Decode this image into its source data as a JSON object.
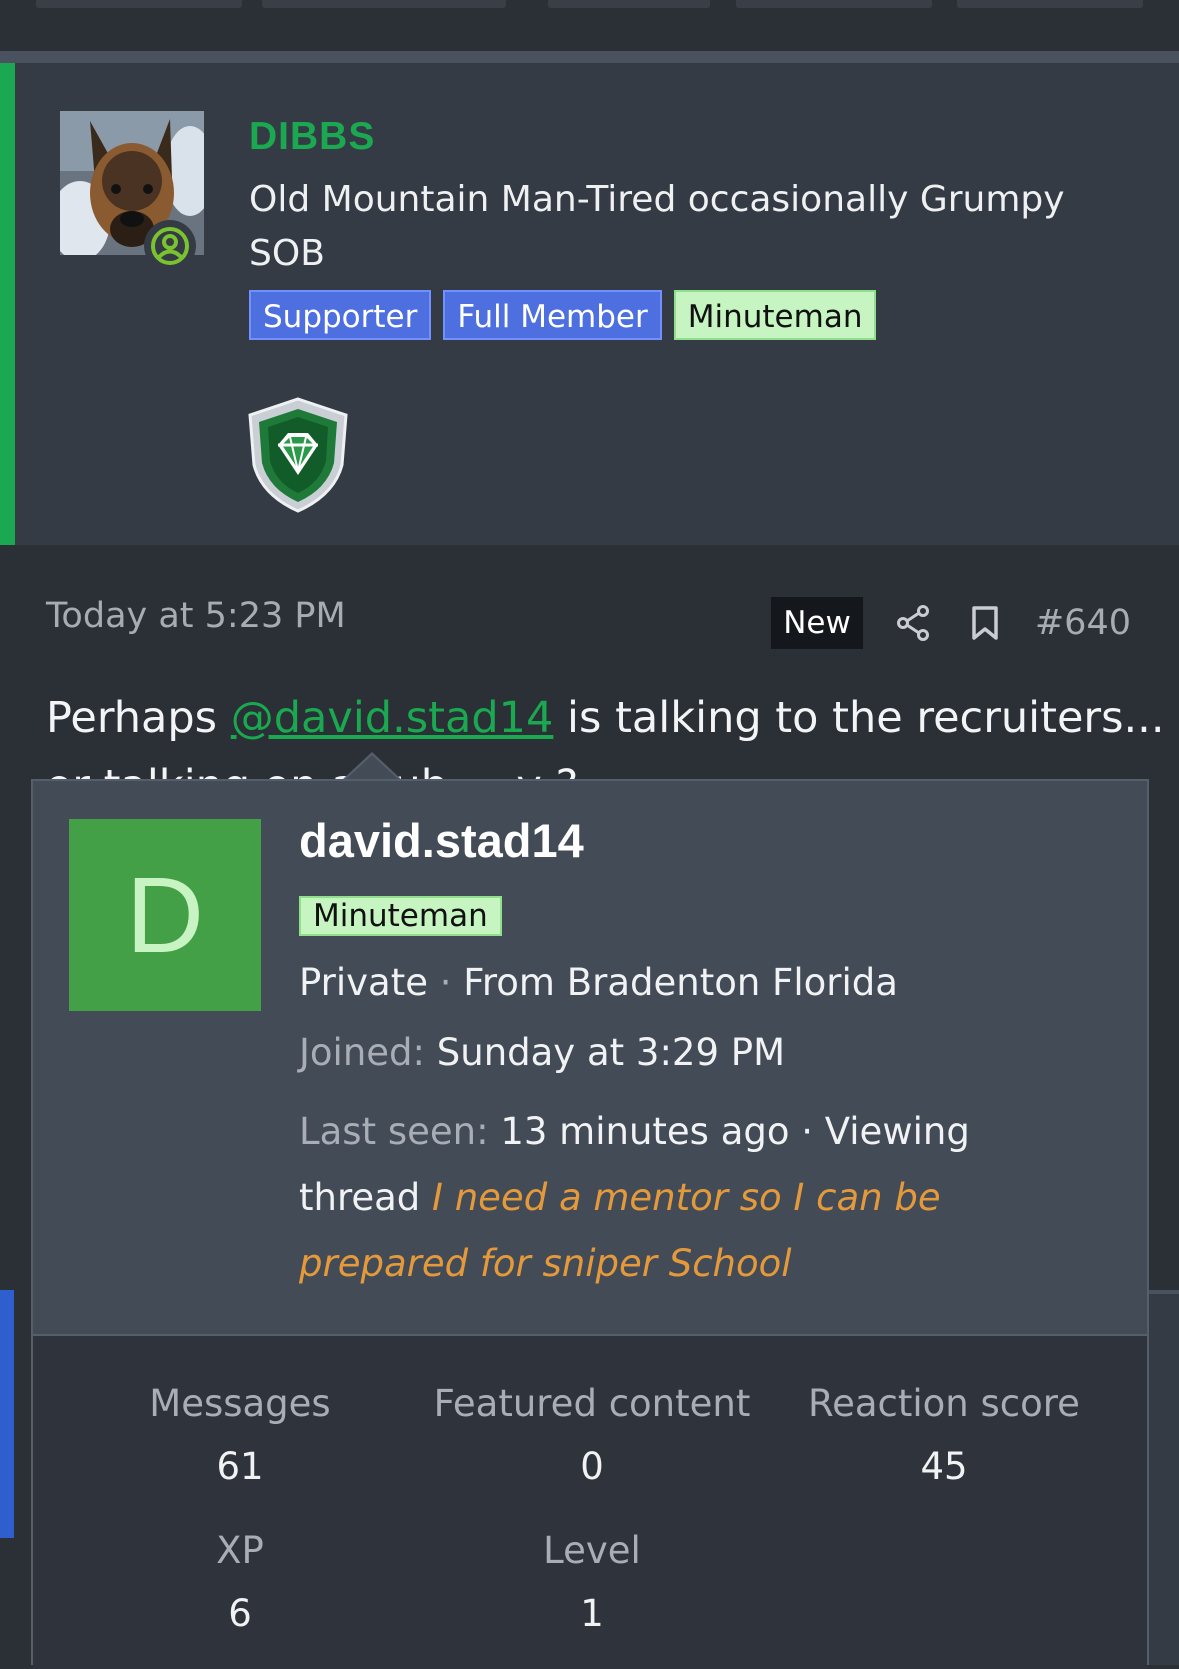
{
  "author": {
    "name": "DIBBS",
    "title": "Old Mountain Man-Tired occasionally Grumpy SOB",
    "badges": [
      "Supporter",
      "Full Member",
      "Minuteman"
    ],
    "avatar_icon": "dog-avatar",
    "status_icon": "online-user-icon",
    "trophy_icon": "diamond-shield-trophy-icon",
    "accent_color": "#1aa850"
  },
  "post": {
    "date": "Today at 5:23 PM",
    "new_label": "New",
    "number": "#640",
    "text_before": "Perhaps ",
    "mention": "@david.stad14",
    "text_after": " is talking to the recruiters...",
    "second_line": "or talking on a sub ... y ?"
  },
  "popup": {
    "avatar_letter": "D",
    "avatar_color": "#43a047",
    "username": "david.stad14",
    "badge": "Minuteman",
    "rank": "Private",
    "sep": " · ",
    "location": "From Bradenton Florida",
    "joined_label": "Joined:",
    "joined_value": "Sunday at 3:29 PM",
    "last_seen_label": "Last seen:",
    "last_seen_value": "13 minutes ago · Viewing thread",
    "thread_title": "I need a mentor so I can be prepared for sniper School",
    "stats": [
      {
        "label": "Messages",
        "value": "61"
      },
      {
        "label": "Featured content",
        "value": "0"
      },
      {
        "label": "Reaction score",
        "value": "45"
      },
      {
        "label": "XP",
        "value": "6"
      },
      {
        "label": "Level",
        "value": "1"
      }
    ]
  }
}
